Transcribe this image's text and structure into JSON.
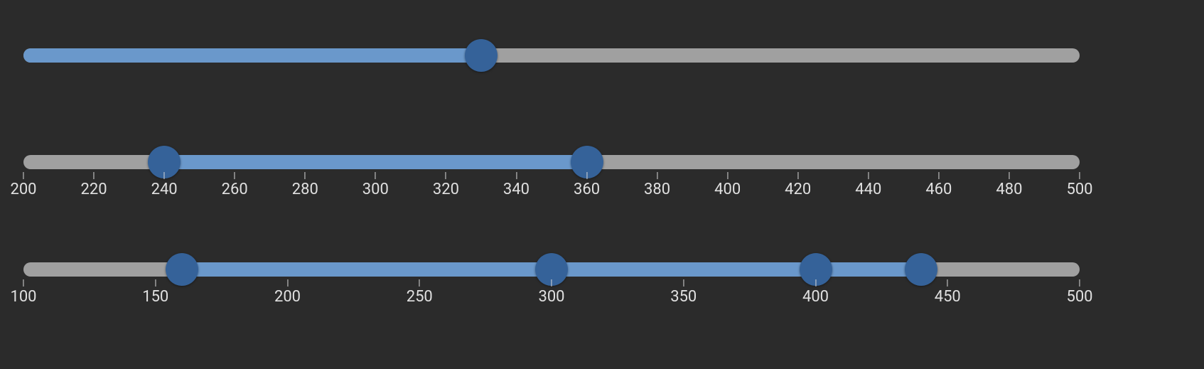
{
  "colors": {
    "background": "#2b2b2b",
    "track": "#a0a0a0",
    "fill": "#6a98cb",
    "thumb": "#356299",
    "tick_text": "#e0e0e0"
  },
  "sliders": [
    {
      "id": "slider-1",
      "type": "single",
      "min": 200,
      "max": 500,
      "values": [
        330
      ],
      "fill_from_start": true,
      "ticks": []
    },
    {
      "id": "slider-2",
      "type": "range",
      "min": 200,
      "max": 500,
      "values": [
        240,
        360
      ],
      "ticks": [
        200,
        220,
        240,
        260,
        280,
        300,
        320,
        340,
        360,
        380,
        400,
        420,
        440,
        460,
        480,
        500
      ]
    },
    {
      "id": "slider-3",
      "type": "multi",
      "min": 100,
      "max": 500,
      "values": [
        160,
        300,
        400,
        440
      ],
      "ticks": [
        100,
        150,
        200,
        250,
        300,
        350,
        400,
        450,
        500
      ]
    }
  ]
}
